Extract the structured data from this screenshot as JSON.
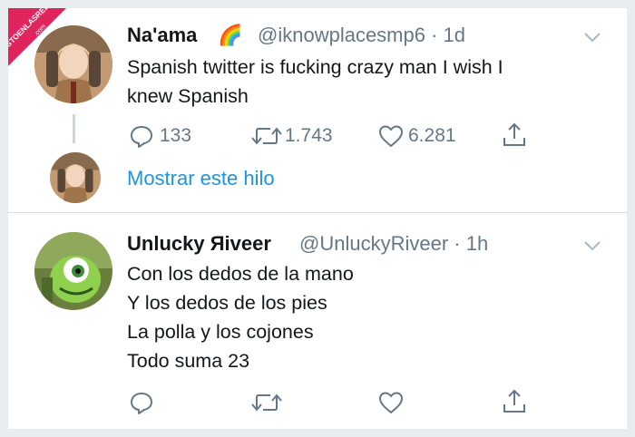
{
  "watermark": {
    "line1": "VISTOENLASREDES",
    "line2": ".com"
  },
  "tweet1": {
    "display_name": "Na'ama",
    "emoji": "🌈",
    "handle": "@iknowplacesmp6 · 1d",
    "text_line1": "Spanish twitter is fucking crazy man I wish I",
    "text_line2": "knew Spanish",
    "replies": "133",
    "retweets": "1.743",
    "likes": "6.281"
  },
  "thread": {
    "show_thread_label": "Mostrar este hilo"
  },
  "tweet2": {
    "display_name": "Unlucky Яiveer",
    "handle": "@UnluckyRiveer · 1h",
    "lines": [
      "Con los dedos de la mano",
      "Y los dedos de los pies",
      "La polla y los cojones",
      "Todo suma 23"
    ]
  },
  "colors": {
    "accent": "#1b95e0",
    "muted": "#657786",
    "text": "#14171a",
    "badge": "#e0245e"
  }
}
